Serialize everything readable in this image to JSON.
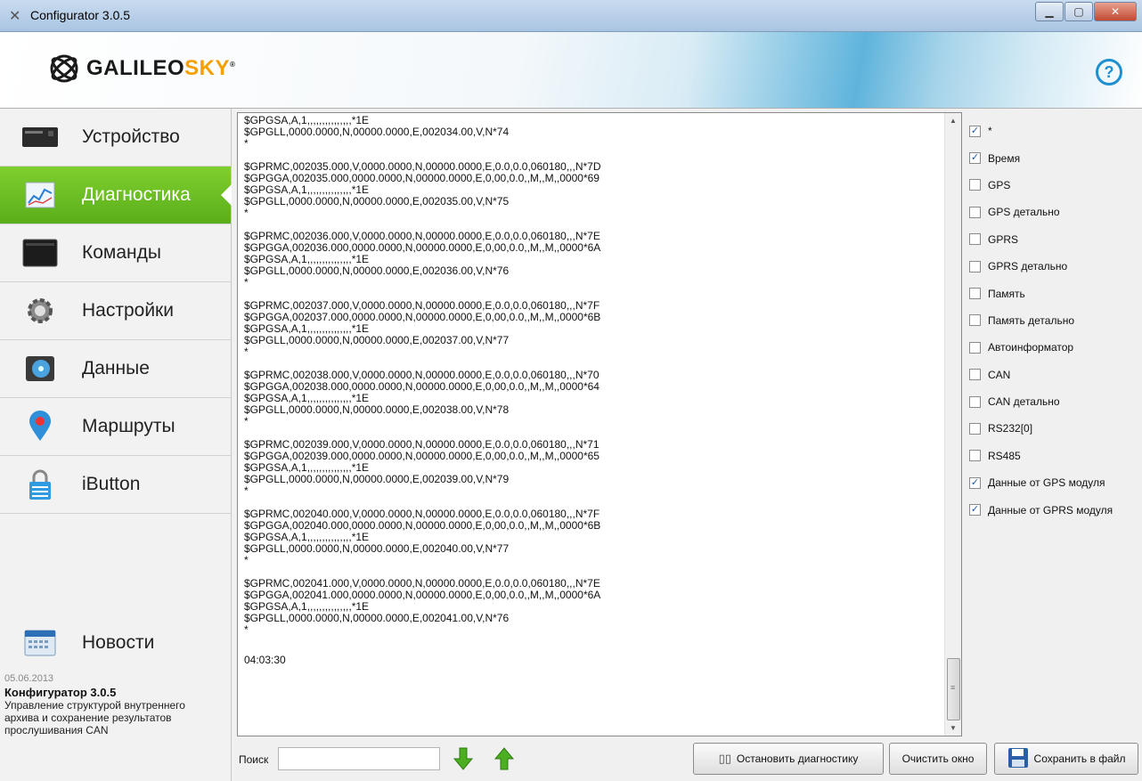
{
  "window": {
    "title": "Configurator 3.0.5"
  },
  "brand": {
    "logo_main": "GALILEO",
    "logo_accent": "SKY",
    "reg": "®"
  },
  "colors": {
    "active_nav": "#6cc024",
    "accent_blue": "#1e8fd0",
    "logo_orange": "#f5a000"
  },
  "nav": [
    {
      "label": "Устройство",
      "icon": "device-icon"
    },
    {
      "label": "Диагностика",
      "icon": "chart-icon",
      "active": true
    },
    {
      "label": "Команды",
      "icon": "terminal-icon"
    },
    {
      "label": "Настройки",
      "icon": "gear-icon"
    },
    {
      "label": "Данные",
      "icon": "data-icon"
    },
    {
      "label": "Маршруты",
      "icon": "map-pin-icon"
    },
    {
      "label": "iButton",
      "icon": "lock-icon"
    }
  ],
  "news": {
    "label": "Новости",
    "date": "05.06.2013",
    "title": "Конфигуратор 3.0.5",
    "text": "Управление структурой внутреннего архива и сохранение результатов прослушивания CAN"
  },
  "log_lines": [
    "$GPGSA,A,1,,,,,,,,,,,,,,,*1E",
    "$GPGLL,0000.0000,N,00000.0000,E,002034.00,V,N*74",
    "*",
    "",
    "$GPRMC,002035.000,V,0000.0000,N,00000.0000,E,0.0,0.0,060180,,,N*7D",
    "$GPGGA,002035.000,0000.0000,N,00000.0000,E,0,00,0.0,,M,,M,,0000*69",
    "$GPGSA,A,1,,,,,,,,,,,,,,,*1E",
    "$GPGLL,0000.0000,N,00000.0000,E,002035.00,V,N*75",
    "*",
    "",
    "$GPRMC,002036.000,V,0000.0000,N,00000.0000,E,0.0,0.0,060180,,,N*7E",
    "$GPGGA,002036.000,0000.0000,N,00000.0000,E,0,00,0.0,,M,,M,,0000*6A",
    "$GPGSA,A,1,,,,,,,,,,,,,,,*1E",
    "$GPGLL,0000.0000,N,00000.0000,E,002036.00,V,N*76",
    "*",
    "",
    "$GPRMC,002037.000,V,0000.0000,N,00000.0000,E,0.0,0.0,060180,,,N*7F",
    "$GPGGA,002037.000,0000.0000,N,00000.0000,E,0,00,0.0,,M,,M,,0000*6B",
    "$GPGSA,A,1,,,,,,,,,,,,,,,*1E",
    "$GPGLL,0000.0000,N,00000.0000,E,002037.00,V,N*77",
    "*",
    "",
    "$GPRMC,002038.000,V,0000.0000,N,00000.0000,E,0.0,0.0,060180,,,N*70",
    "$GPGGA,002038.000,0000.0000,N,00000.0000,E,0,00,0.0,,M,,M,,0000*64",
    "$GPGSA,A,1,,,,,,,,,,,,,,,*1E",
    "$GPGLL,0000.0000,N,00000.0000,E,002038.00,V,N*78",
    "*",
    "",
    "$GPRMC,002039.000,V,0000.0000,N,00000.0000,E,0.0,0.0,060180,,,N*71",
    "$GPGGA,002039.000,0000.0000,N,00000.0000,E,0,00,0.0,,M,,M,,0000*65",
    "$GPGSA,A,1,,,,,,,,,,,,,,,*1E",
    "$GPGLL,0000.0000,N,00000.0000,E,002039.00,V,N*79",
    "*",
    "",
    "$GPRMC,002040.000,V,0000.0000,N,00000.0000,E,0.0,0.0,060180,,,N*7F",
    "$GPGGA,002040.000,0000.0000,N,00000.0000,E,0,00,0.0,,M,,M,,0000*6B",
    "$GPGSA,A,1,,,,,,,,,,,,,,,*1E",
    "$GPGLL,0000.0000,N,00000.0000,E,002040.00,V,N*77",
    "*",
    "",
    "$GPRMC,002041.000,V,0000.0000,N,00000.0000,E,0.0,0.0,060180,,,N*7E",
    "$GPGGA,002041.000,0000.0000,N,00000.0000,E,0,00,0.0,,M,,M,,0000*6A",
    "$GPGSA,A,1,,,,,,,,,,,,,,,*1E",
    "$GPGLL,0000.0000,N,00000.0000,E,002041.00,V,N*76",
    "*",
    "",
    "04:03:30"
  ],
  "filters": [
    {
      "label": "*",
      "checked": true
    },
    {
      "label": "Время",
      "checked": true
    },
    {
      "label": "GPS",
      "checked": false
    },
    {
      "label": "GPS детально",
      "checked": false
    },
    {
      "label": "GPRS",
      "checked": false
    },
    {
      "label": "GPRS детально",
      "checked": false
    },
    {
      "label": "Память",
      "checked": false
    },
    {
      "label": "Память детально",
      "checked": false
    },
    {
      "label": "Автоинформатор",
      "checked": false
    },
    {
      "label": "CAN",
      "checked": false
    },
    {
      "label": "CAN детально",
      "checked": false
    },
    {
      "label": "RS232[0]",
      "checked": false
    },
    {
      "label": "RS485",
      "checked": false
    },
    {
      "label": "Данные от GPS модуля",
      "checked": true
    },
    {
      "label": "Данные от GPRS модуля",
      "checked": true
    }
  ],
  "search": {
    "label": "Поиск",
    "value": ""
  },
  "buttons": {
    "stop": "Остановить диагностику",
    "clear": "Очистить окно",
    "save": "Сохранить в файл"
  }
}
